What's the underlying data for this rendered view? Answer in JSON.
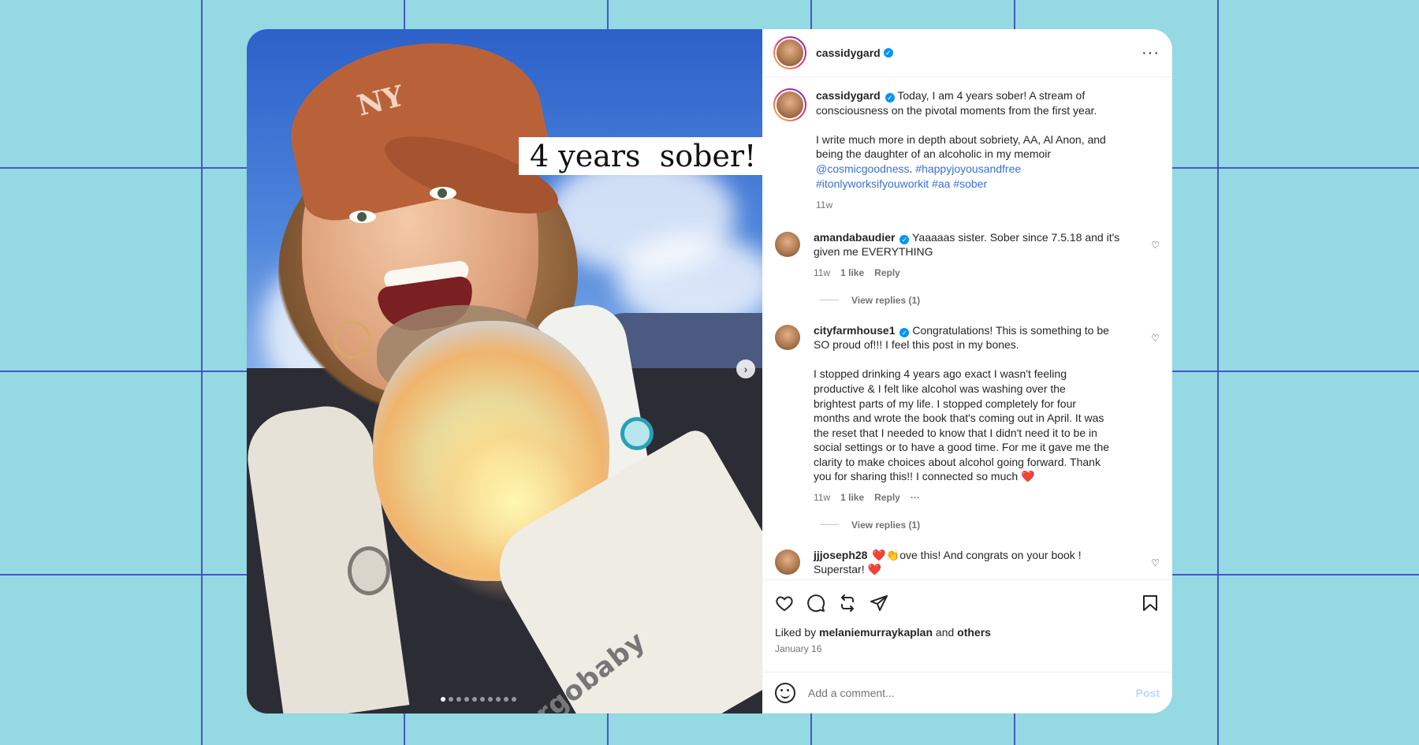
{
  "post": {
    "username": "cassidygard",
    "caption_lines": [
      "Today, I am 4 years sober! A stream of",
      "consciousness on the pivotal moments from the first year."
    ],
    "caption_p2_lines": [
      "I write much more in depth about sobriety, AA, Al Anon, and",
      "being the daughter of an alcoholic in my memoir"
    ],
    "caption_mention": "@cosmicgoodness",
    "caption_tag1": "#happyjoyousandfree",
    "caption_tag2": "#itonlyworksifyouworkit",
    "caption_tag3": "#aa",
    "caption_tag4": "#sober",
    "caption_time": "11w",
    "image_text": "4 years  sober!",
    "image_brand": "ergobaby"
  },
  "comments": [
    {
      "username": "amandabaudier",
      "text_lines": [
        "Yaaaaas sister. Sober since 7.5.18 and it's",
        "given me EVERYTHING"
      ],
      "time": "11w",
      "likes": "1 like",
      "reply": "Reply",
      "view_replies": "View replies (1)"
    },
    {
      "username": "cityfarmhouse1",
      "text_lines": [
        "Congratulations! This is something to be",
        "SO proud of!!! I feel this post in my bones."
      ],
      "text_p2_lines": [
        "I stopped drinking 4 years ago exact I wasn't feeling",
        "productive & I felt like alcohol was washing over the",
        "brightest parts of my life. I stopped completely for four",
        "months and wrote the book that's coming out in April. It was",
        "the reset that I needed to know that I didn't need it to be in",
        "social settings or to have a good time. For me it gave me the",
        "clarity to make choices about alcohol going forward. Thank",
        "you for sharing this!! I connected so much ❤️"
      ],
      "time": "11w",
      "likes": "1 like",
      "reply": "Reply",
      "view_replies": "View replies (1)"
    },
    {
      "username": "jjjoseph28",
      "text_lines": [
        "❤️👏ove this! And congrats on your book !",
        "Superstar! ❤️"
      ]
    }
  ],
  "likes": {
    "prefix": "Liked by",
    "user": "melaniemurraykaplan",
    "and": "and",
    "others": "others"
  },
  "date": "January 16",
  "add_comment": {
    "placeholder": "Add a comment...",
    "post_label": "Post"
  },
  "colors": {
    "background": "#95d9e3",
    "gridlines": "#3b48c9",
    "link": "#3b6fd8",
    "verified": "#0095f6"
  }
}
